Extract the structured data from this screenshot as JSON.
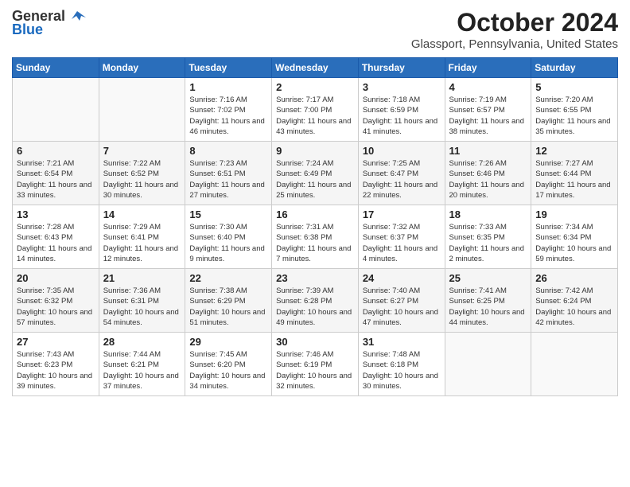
{
  "logo": {
    "general": "General",
    "blue": "Blue"
  },
  "title": {
    "month": "October 2024",
    "location": "Glassport, Pennsylvania, United States"
  },
  "weekdays": [
    "Sunday",
    "Monday",
    "Tuesday",
    "Wednesday",
    "Thursday",
    "Friday",
    "Saturday"
  ],
  "weeks": [
    [
      {
        "day": "",
        "sunrise": "",
        "sunset": "",
        "daylight": ""
      },
      {
        "day": "",
        "sunrise": "",
        "sunset": "",
        "daylight": ""
      },
      {
        "day": "1",
        "sunrise": "Sunrise: 7:16 AM",
        "sunset": "Sunset: 7:02 PM",
        "daylight": "Daylight: 11 hours and 46 minutes."
      },
      {
        "day": "2",
        "sunrise": "Sunrise: 7:17 AM",
        "sunset": "Sunset: 7:00 PM",
        "daylight": "Daylight: 11 hours and 43 minutes."
      },
      {
        "day": "3",
        "sunrise": "Sunrise: 7:18 AM",
        "sunset": "Sunset: 6:59 PM",
        "daylight": "Daylight: 11 hours and 41 minutes."
      },
      {
        "day": "4",
        "sunrise": "Sunrise: 7:19 AM",
        "sunset": "Sunset: 6:57 PM",
        "daylight": "Daylight: 11 hours and 38 minutes."
      },
      {
        "day": "5",
        "sunrise": "Sunrise: 7:20 AM",
        "sunset": "Sunset: 6:55 PM",
        "daylight": "Daylight: 11 hours and 35 minutes."
      }
    ],
    [
      {
        "day": "6",
        "sunrise": "Sunrise: 7:21 AM",
        "sunset": "Sunset: 6:54 PM",
        "daylight": "Daylight: 11 hours and 33 minutes."
      },
      {
        "day": "7",
        "sunrise": "Sunrise: 7:22 AM",
        "sunset": "Sunset: 6:52 PM",
        "daylight": "Daylight: 11 hours and 30 minutes."
      },
      {
        "day": "8",
        "sunrise": "Sunrise: 7:23 AM",
        "sunset": "Sunset: 6:51 PM",
        "daylight": "Daylight: 11 hours and 27 minutes."
      },
      {
        "day": "9",
        "sunrise": "Sunrise: 7:24 AM",
        "sunset": "Sunset: 6:49 PM",
        "daylight": "Daylight: 11 hours and 25 minutes."
      },
      {
        "day": "10",
        "sunrise": "Sunrise: 7:25 AM",
        "sunset": "Sunset: 6:47 PM",
        "daylight": "Daylight: 11 hours and 22 minutes."
      },
      {
        "day": "11",
        "sunrise": "Sunrise: 7:26 AM",
        "sunset": "Sunset: 6:46 PM",
        "daylight": "Daylight: 11 hours and 20 minutes."
      },
      {
        "day": "12",
        "sunrise": "Sunrise: 7:27 AM",
        "sunset": "Sunset: 6:44 PM",
        "daylight": "Daylight: 11 hours and 17 minutes."
      }
    ],
    [
      {
        "day": "13",
        "sunrise": "Sunrise: 7:28 AM",
        "sunset": "Sunset: 6:43 PM",
        "daylight": "Daylight: 11 hours and 14 minutes."
      },
      {
        "day": "14",
        "sunrise": "Sunrise: 7:29 AM",
        "sunset": "Sunset: 6:41 PM",
        "daylight": "Daylight: 11 hours and 12 minutes."
      },
      {
        "day": "15",
        "sunrise": "Sunrise: 7:30 AM",
        "sunset": "Sunset: 6:40 PM",
        "daylight": "Daylight: 11 hours and 9 minutes."
      },
      {
        "day": "16",
        "sunrise": "Sunrise: 7:31 AM",
        "sunset": "Sunset: 6:38 PM",
        "daylight": "Daylight: 11 hours and 7 minutes."
      },
      {
        "day": "17",
        "sunrise": "Sunrise: 7:32 AM",
        "sunset": "Sunset: 6:37 PM",
        "daylight": "Daylight: 11 hours and 4 minutes."
      },
      {
        "day": "18",
        "sunrise": "Sunrise: 7:33 AM",
        "sunset": "Sunset: 6:35 PM",
        "daylight": "Daylight: 11 hours and 2 minutes."
      },
      {
        "day": "19",
        "sunrise": "Sunrise: 7:34 AM",
        "sunset": "Sunset: 6:34 PM",
        "daylight": "Daylight: 10 hours and 59 minutes."
      }
    ],
    [
      {
        "day": "20",
        "sunrise": "Sunrise: 7:35 AM",
        "sunset": "Sunset: 6:32 PM",
        "daylight": "Daylight: 10 hours and 57 minutes."
      },
      {
        "day": "21",
        "sunrise": "Sunrise: 7:36 AM",
        "sunset": "Sunset: 6:31 PM",
        "daylight": "Daylight: 10 hours and 54 minutes."
      },
      {
        "day": "22",
        "sunrise": "Sunrise: 7:38 AM",
        "sunset": "Sunset: 6:29 PM",
        "daylight": "Daylight: 10 hours and 51 minutes."
      },
      {
        "day": "23",
        "sunrise": "Sunrise: 7:39 AM",
        "sunset": "Sunset: 6:28 PM",
        "daylight": "Daylight: 10 hours and 49 minutes."
      },
      {
        "day": "24",
        "sunrise": "Sunrise: 7:40 AM",
        "sunset": "Sunset: 6:27 PM",
        "daylight": "Daylight: 10 hours and 47 minutes."
      },
      {
        "day": "25",
        "sunrise": "Sunrise: 7:41 AM",
        "sunset": "Sunset: 6:25 PM",
        "daylight": "Daylight: 10 hours and 44 minutes."
      },
      {
        "day": "26",
        "sunrise": "Sunrise: 7:42 AM",
        "sunset": "Sunset: 6:24 PM",
        "daylight": "Daylight: 10 hours and 42 minutes."
      }
    ],
    [
      {
        "day": "27",
        "sunrise": "Sunrise: 7:43 AM",
        "sunset": "Sunset: 6:23 PM",
        "daylight": "Daylight: 10 hours and 39 minutes."
      },
      {
        "day": "28",
        "sunrise": "Sunrise: 7:44 AM",
        "sunset": "Sunset: 6:21 PM",
        "daylight": "Daylight: 10 hours and 37 minutes."
      },
      {
        "day": "29",
        "sunrise": "Sunrise: 7:45 AM",
        "sunset": "Sunset: 6:20 PM",
        "daylight": "Daylight: 10 hours and 34 minutes."
      },
      {
        "day": "30",
        "sunrise": "Sunrise: 7:46 AM",
        "sunset": "Sunset: 6:19 PM",
        "daylight": "Daylight: 10 hours and 32 minutes."
      },
      {
        "day": "31",
        "sunrise": "Sunrise: 7:48 AM",
        "sunset": "Sunset: 6:18 PM",
        "daylight": "Daylight: 10 hours and 30 minutes."
      },
      {
        "day": "",
        "sunrise": "",
        "sunset": "",
        "daylight": ""
      },
      {
        "day": "",
        "sunrise": "",
        "sunset": "",
        "daylight": ""
      }
    ]
  ]
}
